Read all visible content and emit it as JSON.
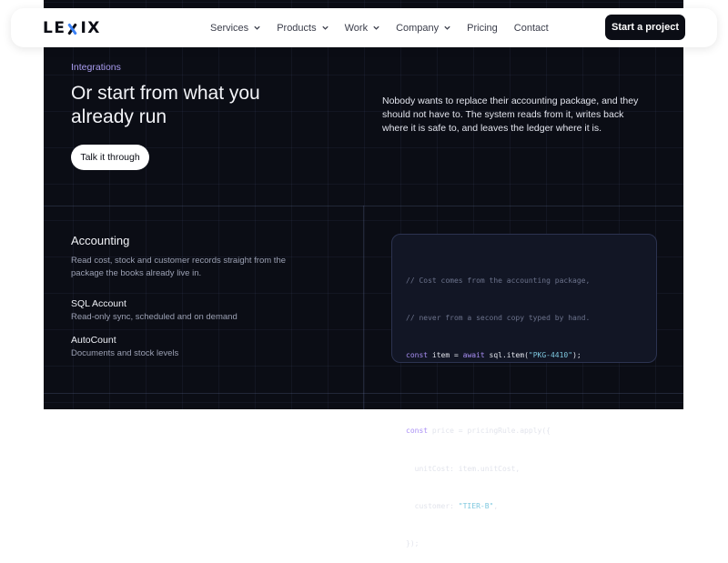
{
  "navbar": {
    "logo_left": "LE",
    "logo_right": "IX",
    "links": [
      {
        "label": "Services",
        "dropdown": true
      },
      {
        "label": "Products",
        "dropdown": true
      },
      {
        "label": "Work",
        "dropdown": true
      },
      {
        "label": "Company",
        "dropdown": true
      },
      {
        "label": "Pricing",
        "dropdown": false
      },
      {
        "label": "Contact",
        "dropdown": false
      }
    ],
    "cta_label": "Start a project"
  },
  "hero": {
    "eyebrow": "Integrations",
    "headline": "Or start from what you already run",
    "intro": "Nobody wants to replace their accounting package, and they should not have to. The system reads from it, writes back where it is safe to, and leaves the ledger where it is.",
    "button_label": "Talk it through"
  },
  "accounting": {
    "title": "Accounting",
    "description": "Read cost, stock and customer records straight from the package the books already live in.",
    "integrations": [
      {
        "name": "SQL Account",
        "detail": "Read-only sync, scheduled and on demand"
      },
      {
        "name": "AutoCount",
        "detail": "Documents and stock levels"
      }
    ]
  },
  "code": {
    "lines": [
      {
        "comment": "// Cost comes from the accounting package,"
      },
      {
        "comment": "// never from a second copy typed by hand."
      },
      {
        "kw": "const",
        "text": " item = ",
        "kw2": "await",
        "text2": " sql.item(",
        "str": "\"PKG-4410\"",
        "text3": ");"
      },
      {},
      {
        "kw": "const",
        "text": " price = pricingRule.apply({"
      },
      {
        "text": "  unitCost: item.unitCost,"
      },
      {
        "text": "  customer: ",
        "str": "\"TIER-B\"",
        "text3": ","
      },
      {
        "text": "});"
      }
    ]
  },
  "colors": {
    "background_dark": "#0b0d15",
    "accent_purple": "#a99cf0",
    "code_string": "#7ec8df",
    "code_keyword": "#a98ff5"
  }
}
